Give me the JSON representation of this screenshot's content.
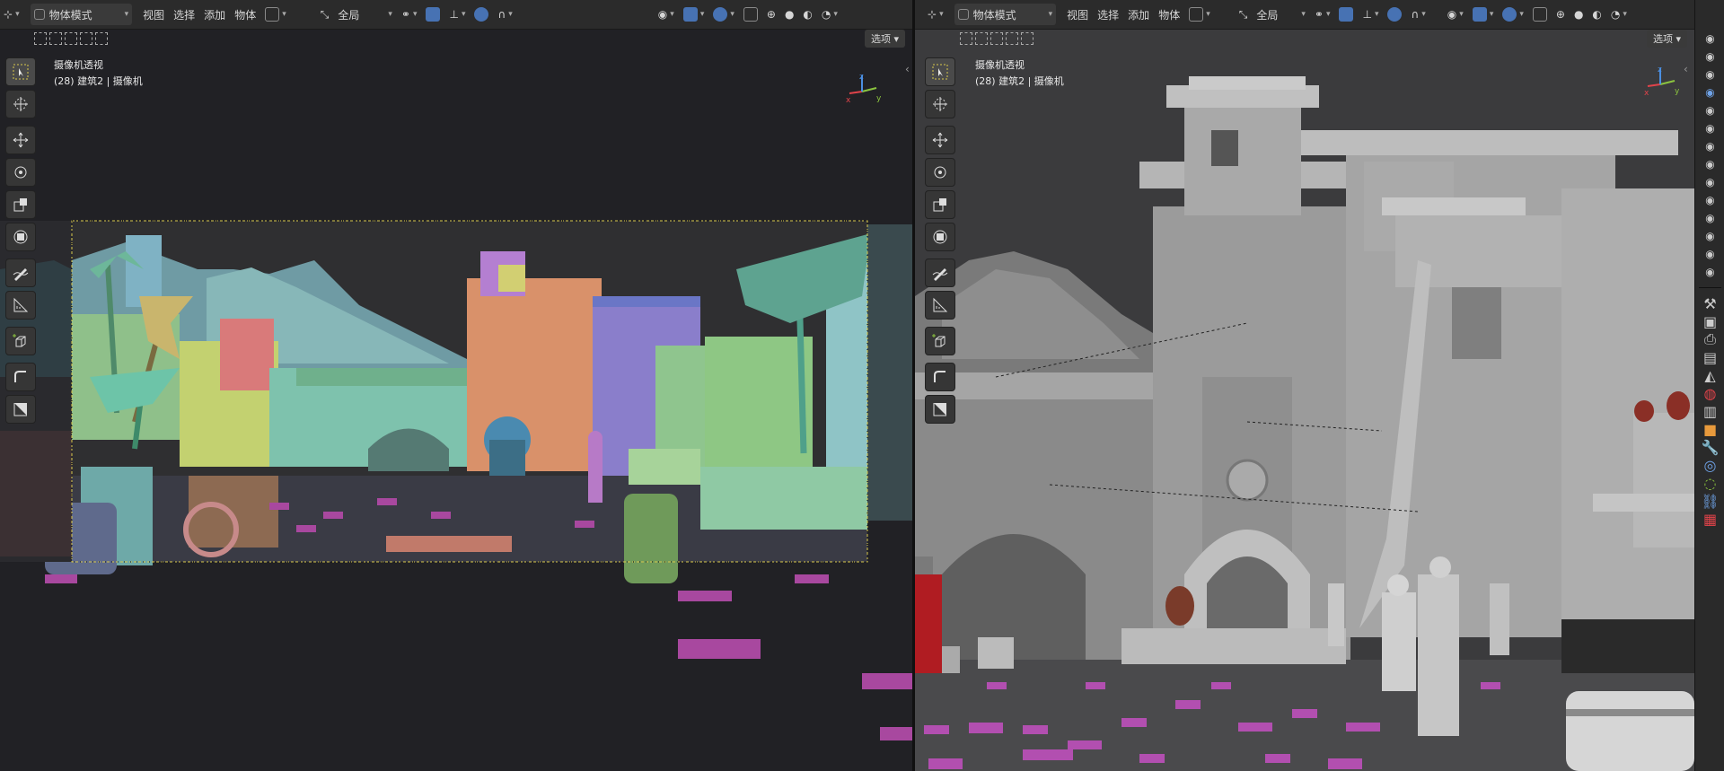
{
  "left_viewport": {
    "header": {
      "mode": "物体模式",
      "menu": [
        "视图",
        "选择",
        "添加",
        "物体"
      ],
      "transform_orientation": "全局"
    },
    "options_label": "选项",
    "overlay_line1": "摄像机透视",
    "overlay_line2": "(28) 建筑2 | 摄像机"
  },
  "right_viewport": {
    "header": {
      "mode": "物体模式",
      "menu": [
        "视图",
        "选择",
        "添加",
        "物体"
      ],
      "transform_orientation": "全局"
    },
    "options_label": "选项",
    "overlay_line1": "摄像机透视",
    "overlay_line2": "(28) 建筑2 | 摄像机"
  },
  "gizmo": {
    "x": "x",
    "y": "y",
    "z": "z"
  },
  "tools": [
    "select-box",
    "cursor",
    "move",
    "rotate",
    "scale",
    "transform",
    "annotate",
    "measure",
    "add-cube",
    "extrude",
    "shear"
  ],
  "colors": {
    "header_bg": "#2b2b2b",
    "accent": "#4772b3",
    "axis_x": "#e0434a",
    "axis_y": "#8bc33f",
    "axis_z": "#4b8fe2",
    "magenta_marker": "#b24fb0"
  }
}
